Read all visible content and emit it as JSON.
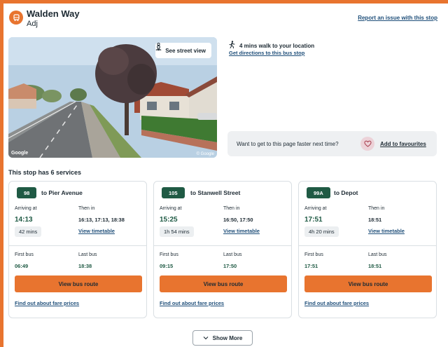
{
  "header": {
    "stop_name": "Walden Way",
    "stop_sub": "Adj",
    "report_link": "Report an issue with this stop"
  },
  "street_view": {
    "button_label": "See street view",
    "google_mark": "Google",
    "copyright": "© Google"
  },
  "walk": {
    "text": "4 mins walk to your location",
    "directions_link": "Get directions to this bus stop"
  },
  "favourites": {
    "question": "Want to get to this page faster next time?",
    "link": "Add to favourites"
  },
  "services_title": "This stop has 6 services",
  "labels": {
    "arriving_at": "Arriving at",
    "then_in": "Then in",
    "view_timetable": "View timetable",
    "first_bus": "First bus",
    "last_bus": "Last bus",
    "view_route": "View bus route",
    "fare_link": "Find out about fare prices"
  },
  "services": [
    {
      "route": "98",
      "destination": "to Pier Avenue",
      "arriving": "14:13",
      "then_in": "16:13, 17:13, 18:38",
      "minutes": "42 mins",
      "first_bus": "06:49",
      "last_bus": "18:38"
    },
    {
      "route": "105",
      "destination": "to Stanwell Street",
      "arriving": "15:25",
      "then_in": "16:50, 17:50",
      "minutes": "1h 54 mins",
      "first_bus": "09:15",
      "last_bus": "17:50"
    },
    {
      "route": "99A",
      "destination": "to Depot",
      "arriving": "17:51",
      "then_in": "18:51",
      "minutes": "4h 20 mins",
      "first_bus": "17:51",
      "last_bus": "18:51"
    }
  ],
  "show_more": "Show More",
  "colors": {
    "accent": "#e8742f",
    "route_badge": "#1f5a44",
    "link": "#1f4f7a"
  }
}
